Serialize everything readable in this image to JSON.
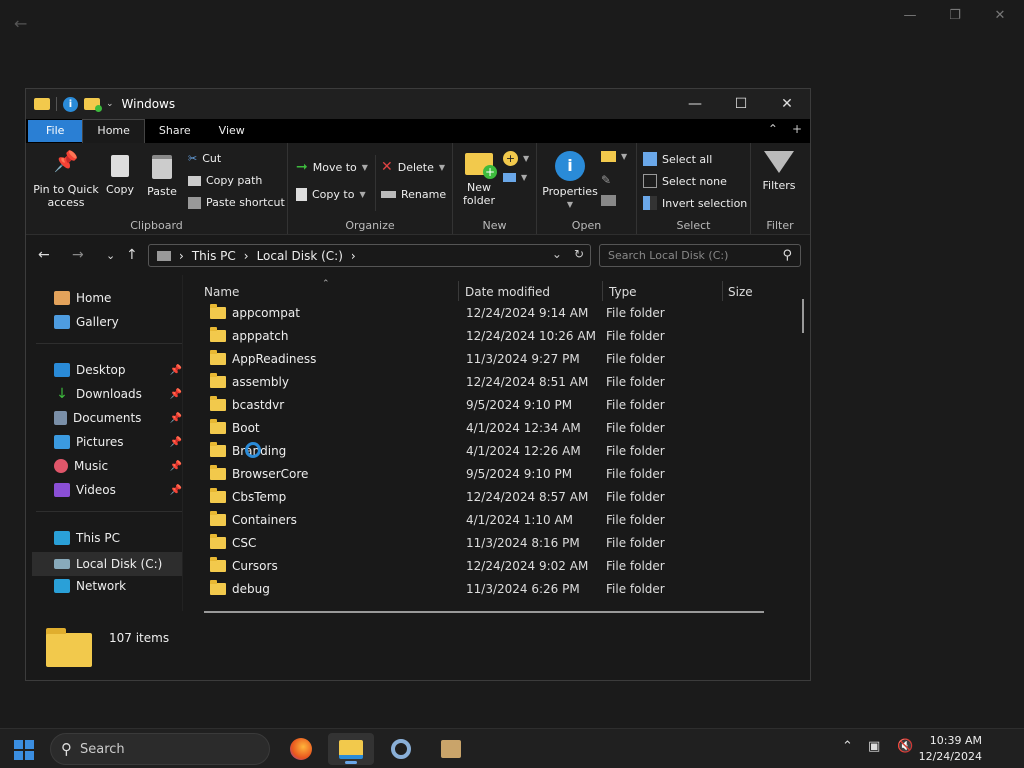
{
  "window": {
    "title": "Windows"
  },
  "ribbon_tabs": [
    "File",
    "Home",
    "Share",
    "View"
  ],
  "clipboard": {
    "pin": "Pin to Quick access",
    "copy": "Copy",
    "paste": "Paste",
    "cut": "Cut",
    "copy_path": "Copy path",
    "paste_shortcut": "Paste shortcut",
    "label": "Clipboard"
  },
  "organize": {
    "move_to": "Move to",
    "copy_to": "Copy to",
    "delete": "Delete",
    "rename": "Rename",
    "label": "Organize"
  },
  "new_group": {
    "new_folder": "New folder",
    "label": "New"
  },
  "open_group": {
    "properties": "Properties",
    "label": "Open"
  },
  "select_group": {
    "select_all": "Select all",
    "select_none": "Select none",
    "invert": "Invert selection",
    "label": "Select"
  },
  "filter_group": {
    "filters": "Filters",
    "label": "Filter"
  },
  "breadcrumb": [
    "This PC",
    "Local Disk (C:)"
  ],
  "search": {
    "placeholder": "Search Local Disk (C:)"
  },
  "nav_pane": {
    "home": "Home",
    "gallery": "Gallery",
    "desktop": "Desktop",
    "downloads": "Downloads",
    "documents": "Documents",
    "pictures": "Pictures",
    "music": "Music",
    "videos": "Videos",
    "this_pc": "This PC",
    "local_disk": "Local Disk (C:)",
    "network": "Network"
  },
  "columns": {
    "name": "Name",
    "date": "Date modified",
    "type": "Type",
    "size": "Size"
  },
  "files": [
    {
      "name": "appcompat",
      "date": "12/24/2024 9:14 AM",
      "type": "File folder"
    },
    {
      "name": "apppatch",
      "date": "12/24/2024 10:26 AM",
      "type": "File folder"
    },
    {
      "name": "AppReadiness",
      "date": "11/3/2024 9:27 PM",
      "type": "File folder"
    },
    {
      "name": "assembly",
      "date": "12/24/2024 8:51 AM",
      "type": "File folder"
    },
    {
      "name": "bcastdvr",
      "date": "9/5/2024 9:10 PM",
      "type": "File folder"
    },
    {
      "name": "Boot",
      "date": "4/1/2024 12:34 AM",
      "type": "File folder"
    },
    {
      "name": "Branding",
      "date": "4/1/2024 12:26 AM",
      "type": "File folder"
    },
    {
      "name": "BrowserCore",
      "date": "9/5/2024 9:10 PM",
      "type": "File folder"
    },
    {
      "name": "CbsTemp",
      "date": "12/24/2024 8:57 AM",
      "type": "File folder"
    },
    {
      "name": "Containers",
      "date": "4/1/2024 1:10 AM",
      "type": "File folder"
    },
    {
      "name": "CSC",
      "date": "11/3/2024 8:16 PM",
      "type": "File folder"
    },
    {
      "name": "Cursors",
      "date": "12/24/2024 9:02 AM",
      "type": "File folder"
    },
    {
      "name": "debug",
      "date": "11/3/2024 6:26 PM",
      "type": "File folder"
    }
  ],
  "status": {
    "item_count": "107 items"
  },
  "taskbar": {
    "search": "Search",
    "time": "10:39 AM",
    "date": "12/24/2024"
  }
}
